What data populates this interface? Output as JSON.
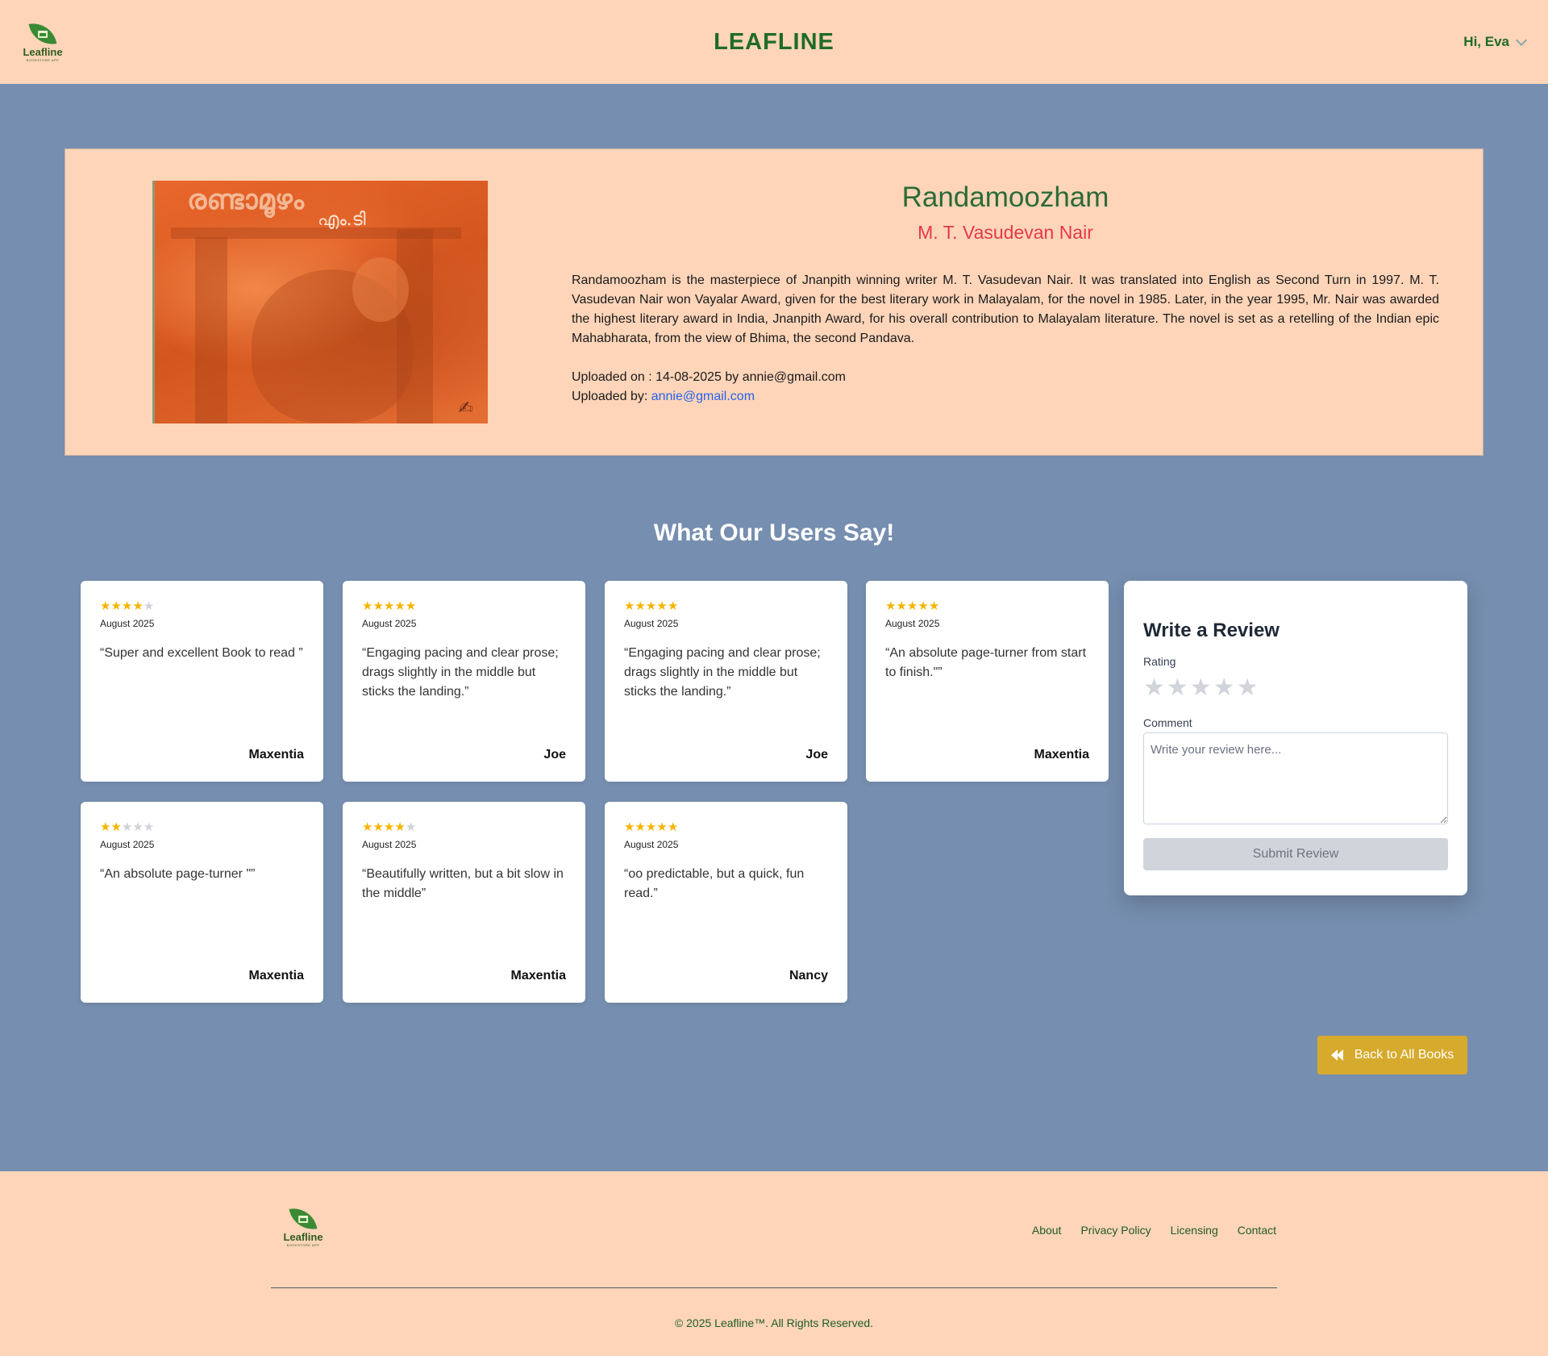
{
  "header": {
    "logo_text": "Leafline",
    "logo_sub": "BOOKSTORE APP",
    "brand": "LEAFLINE",
    "greeting": "Hi, Eva"
  },
  "book": {
    "title": "Randamoozham",
    "author": "M. T. Vasudevan Nair",
    "cover_title": "രണ്ടാമൂഴം",
    "cover_subtitle": "എം.ടി",
    "description": "Randamoozham is the masterpiece of Jnanpith winning writer M. T. Vasudevan Nair. It was translated into English as Second Turn in 1997. M. T. Vasudevan Nair won Vayalar Award, given for the best literary work in Malayalam, for the novel in 1985. Later, in the year 1995, Mr. Nair was awarded the highest literary award in India, Jnanpith Award, for his overall contribution to Malayalam literature. The novel is set as a retelling of the Indian epic Mahabharata, from the view of Bhima, the second Pandava.",
    "uploaded_on": "Uploaded on : 14-08-2025 by annie@gmail.com",
    "uploaded_by_label": "Uploaded by: ",
    "uploaded_by_email": "annie@gmail.com"
  },
  "reviews_section": {
    "title": "What Our Users Say!",
    "reviews": [
      {
        "rating": 4,
        "date": "August 2025",
        "text": "“Super and excellent Book to read ”",
        "author": "Maxentia"
      },
      {
        "rating": 5,
        "date": "August 2025",
        "text": "“Engaging pacing and clear prose; drags slightly in the middle but sticks the landing.”",
        "author": "Joe"
      },
      {
        "rating": 5,
        "date": "August 2025",
        "text": "“Engaging pacing and clear prose; drags slightly in the middle but sticks the landing.”",
        "author": "Joe"
      },
      {
        "rating": 5,
        "date": "August 2025",
        "text": "“An absolute page-turner from start to finish.\"”",
        "author": "Maxentia"
      },
      {
        "rating": 2,
        "date": "August 2025",
        "text": "“An absolute page-turner \"”",
        "author": "Maxentia"
      },
      {
        "rating": 4,
        "date": "August 2025",
        "text": "“Beautifully written, but a bit slow in the middle”",
        "author": "Maxentia"
      },
      {
        "rating": 5,
        "date": "August 2025",
        "text": "“oo predictable, but a quick, fun read.”",
        "author": "Nancy"
      }
    ]
  },
  "write_review": {
    "title": "Write a Review",
    "rating_label": "Rating",
    "comment_label": "Comment",
    "comment_placeholder": "Write your review here...",
    "submit_label": "Submit Review"
  },
  "back_button": {
    "label": "Back to All Books"
  },
  "footer": {
    "links": [
      "About",
      "Privacy Policy",
      "Licensing",
      "Contact"
    ],
    "copyright": "© 2025 Leafline™. All Rights Reserved."
  },
  "colors": {
    "header_bg": "#fed5b9",
    "page_bg": "#768eaf",
    "brand_green": "#1f6b28",
    "author_red": "#e63946",
    "star_gold": "#f5b400",
    "back_button": "#d6aa2c"
  }
}
